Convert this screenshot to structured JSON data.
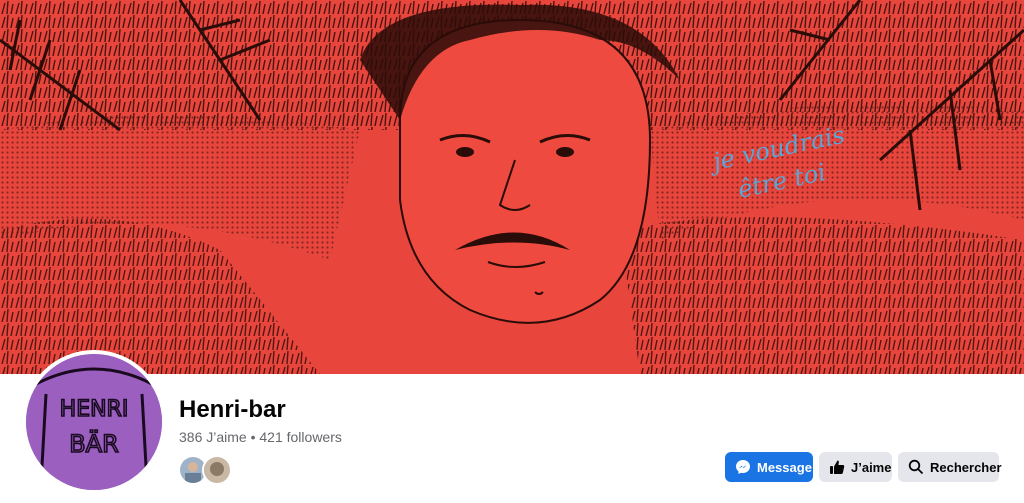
{
  "page": {
    "name": "Henri-bar",
    "stats": "386 J’aime • 421 followers"
  },
  "cover": {
    "handwritten_text_line1": "je voudrais",
    "handwritten_text_line2": "être toi"
  },
  "avatar": {
    "logo_text_line1": "HENRI",
    "logo_text_line2": "BÄR"
  },
  "actions": {
    "message_label": "Message",
    "like_label": "J’aime",
    "search_label": "Rechercher"
  },
  "colors": {
    "accent": "#1b74e4",
    "cover_red": "#e8453c",
    "avatar_purple": "#9b5fc0"
  },
  "icons": [
    "messenger-icon",
    "thumbs-up-icon",
    "search-icon"
  ]
}
